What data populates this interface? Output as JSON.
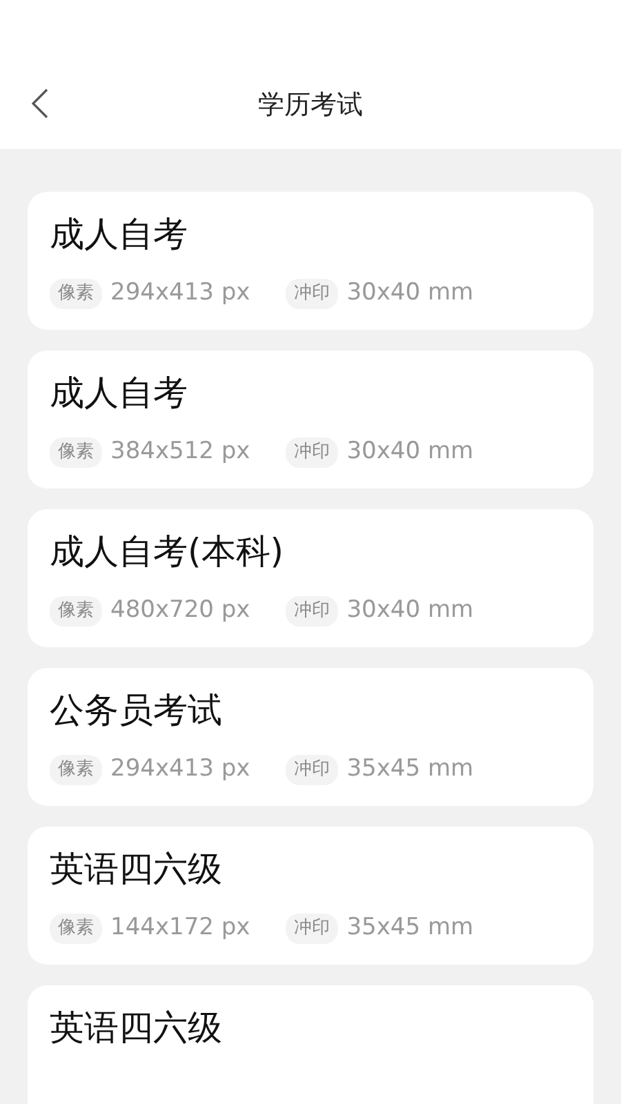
{
  "header": {
    "title": "学历考试"
  },
  "items": [
    {
      "name": "成人自考",
      "details": [
        {
          "tag": "像素",
          "value": "294x413 px"
        },
        {
          "tag": "冲印",
          "value": "30x40 mm"
        }
      ]
    },
    {
      "name": "成人自考",
      "details": [
        {
          "tag": "像素",
          "value": "384x512 px"
        },
        {
          "tag": "冲印",
          "value": "30x40 mm"
        }
      ]
    },
    {
      "name": "成人自考(本科)",
      "details": [
        {
          "tag": "像素",
          "value": "480x720 px"
        },
        {
          "tag": "冲印",
          "value": "30x40 mm"
        }
      ]
    },
    {
      "name": "公务员考试",
      "details": [
        {
          "tag": "像素",
          "value": "294x413 px"
        },
        {
          "tag": "冲印",
          "value": "35x45 mm"
        }
      ]
    },
    {
      "name": "英语四六级",
      "details": [
        {
          "tag": "像素",
          "value": "144x172 px"
        },
        {
          "tag": "冲印",
          "value": "35x45 mm"
        }
      ]
    },
    {
      "name": "英语四六级"
    }
  ]
}
